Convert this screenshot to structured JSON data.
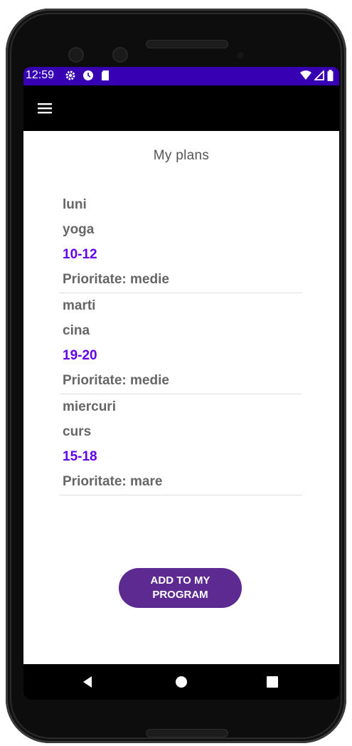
{
  "status_bar": {
    "time": "12:59",
    "left_icons": [
      "settings-icon",
      "circle-icon",
      "sd-card-icon"
    ],
    "right_icons": [
      "wifi-icon",
      "signal-icon",
      "battery-icon"
    ],
    "color": "#3700b3"
  },
  "app_bar": {
    "menu_icon": "hamburger-menu-icon",
    "color": "#000000"
  },
  "page": {
    "title": "My plans"
  },
  "plans": [
    {
      "day": "luni",
      "activity": "yoga",
      "time": "10-12",
      "priority": "Prioritate: medie"
    },
    {
      "day": "marti",
      "activity": "cina",
      "time": "19-20",
      "priority": "Prioritate: medie"
    },
    {
      "day": "miercuri",
      "activity": "curs",
      "time": "15-18",
      "priority": "Prioritate: mare"
    }
  ],
  "add_button": {
    "label": "ADD TO MY\nPROGRAM",
    "color": "#5c2a91"
  },
  "nav_bar": {
    "icons": [
      "back-icon",
      "home-icon",
      "recents-icon"
    ]
  },
  "colors": {
    "accent": "#6200ee",
    "text_gray": "#666666"
  }
}
